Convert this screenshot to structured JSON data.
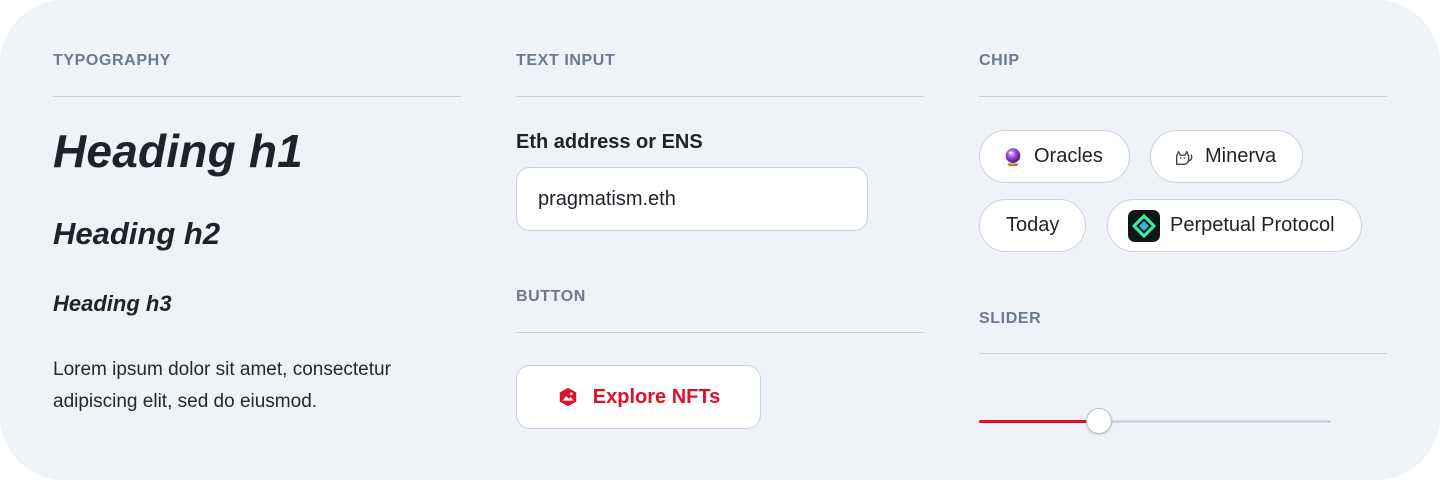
{
  "sections": {
    "typography": "TYPOGRAPHY",
    "text_input": "TEXT INPUT",
    "chip": "CHIP",
    "button": "BUTTON",
    "slider": "SLIDER"
  },
  "typography": {
    "h1": "Heading h1",
    "h2": "Heading h2",
    "h3": "Heading h3",
    "paragraph": "Lorem ipsum dolor sit amet, consectetur adipiscing elit, sed do eiusmod."
  },
  "text_input": {
    "label": "Eth address or ENS",
    "value": "pragmatism.eth"
  },
  "button": {
    "label": "Explore NFTs",
    "icon": "nft-frame-icon",
    "color": "#e0102a"
  },
  "chips": [
    {
      "label": "Oracles",
      "icon": "crystal-ball-icon"
    },
    {
      "label": "Minerva",
      "icon": "cat-icon"
    },
    {
      "label": "Today",
      "icon": ""
    },
    {
      "label": "Perpetual Protocol",
      "icon": "perpetual-protocol-logo-icon"
    }
  ],
  "slider": {
    "value_fraction": 0.34,
    "fill_color": "#e0102a",
    "track_color": "#cfd6e0"
  }
}
